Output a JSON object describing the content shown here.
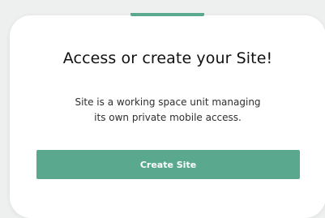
{
  "dialog": {
    "title": "Access or create your Site!",
    "description_line1": "Site is a working space unit managing",
    "description_line2": "its own private mobile access.",
    "create_button_label": "Create Site"
  },
  "colors": {
    "accent": "#5aa98f",
    "card_background": "#ffffff",
    "page_background": "#eef0ef",
    "title_text": "#111111"
  }
}
